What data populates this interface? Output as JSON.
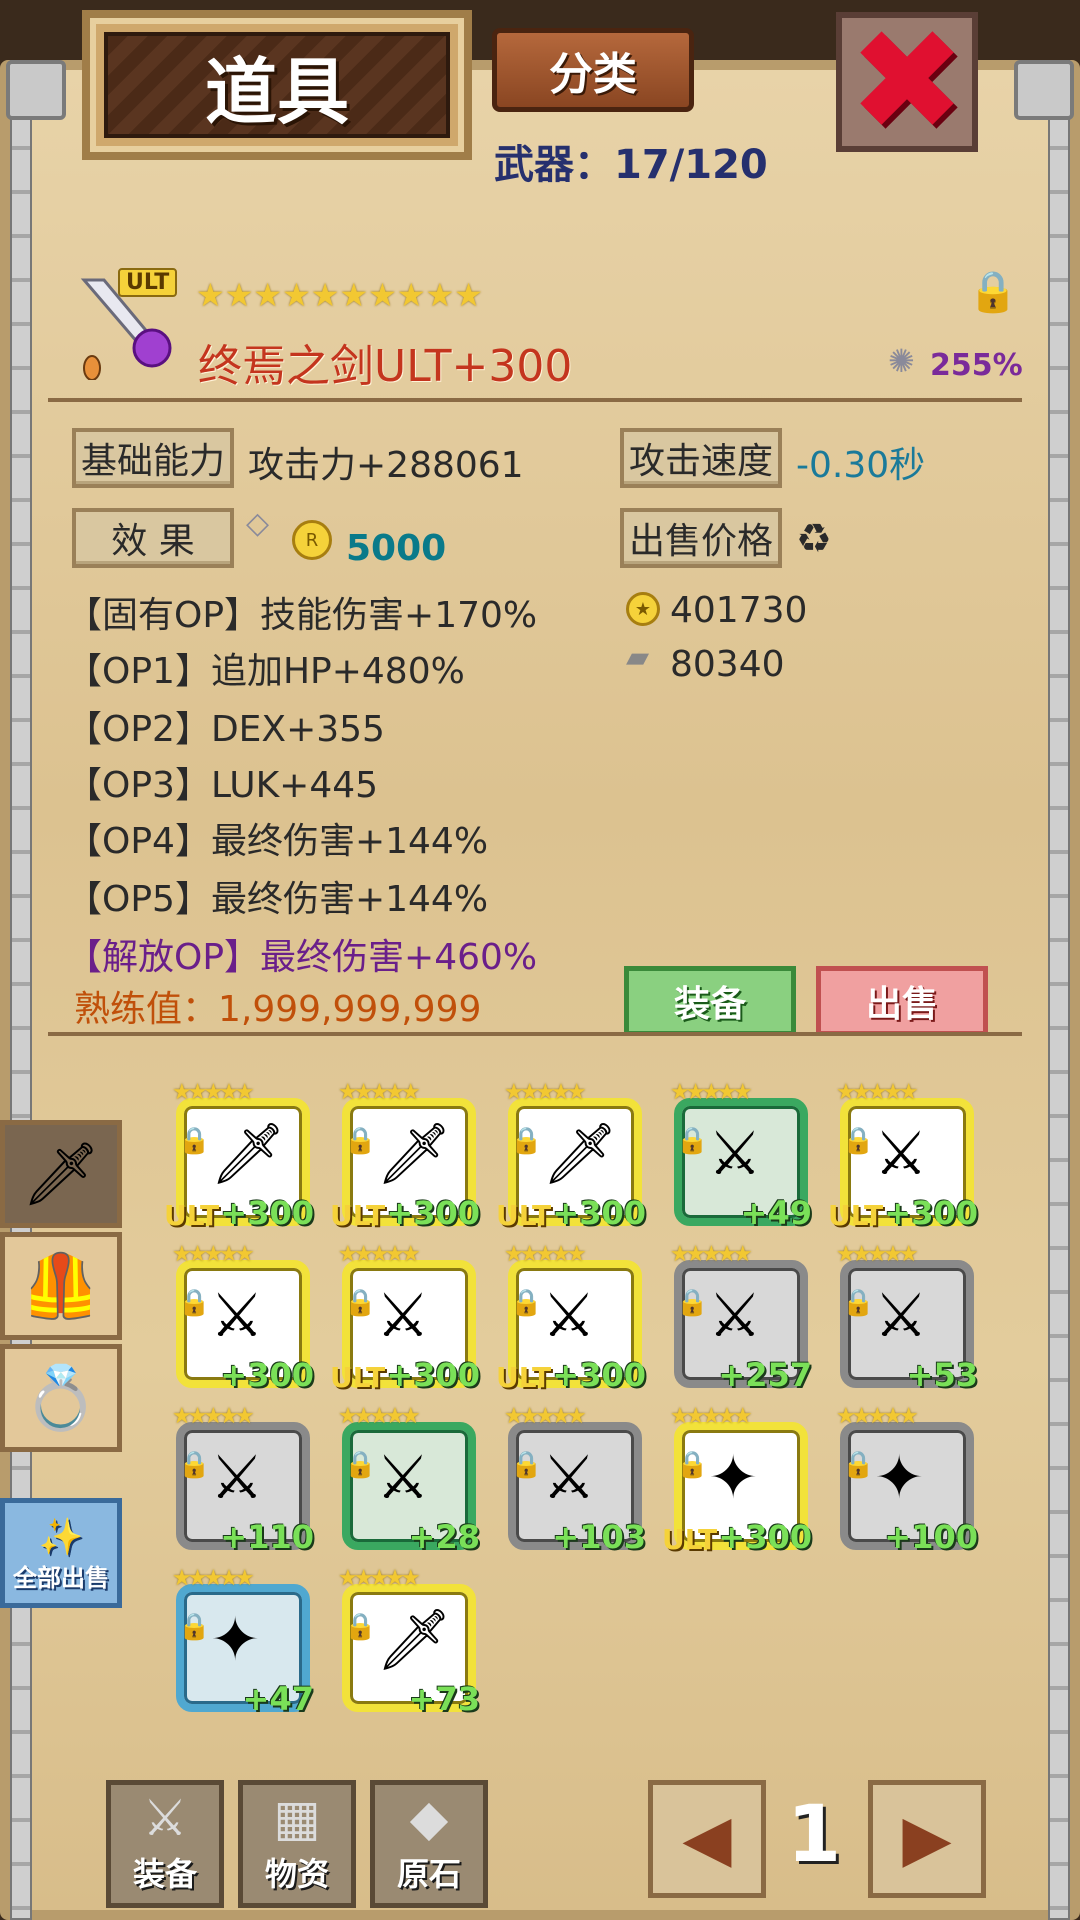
{
  "header": {
    "title": "道具",
    "category_label": "分类",
    "weapon_count": "武器：17/120",
    "close_glyph": "✖"
  },
  "item": {
    "ult_badge": "ULT",
    "stars": "★★★★★★★★★★",
    "name": "终焉之剑ULT+300",
    "percent": "255%",
    "base_label": "基础能力",
    "attack": "攻击力+288061",
    "speed_label": "攻击速度",
    "speed_value": "-0.30秒",
    "effect_label": "效 果",
    "rune_value": "5000",
    "sell_price_label": "出售价格",
    "options": [
      "【固有OP】技能伤害+170%",
      "【OP1】追加HP+480%",
      "【OP2】DEX+355",
      "【OP3】LUK+445",
      "【OP4】最终伤害+144%",
      "【OP5】最终伤害+144%",
      "【解放OP】最终伤害+460%"
    ],
    "mastery": "熟练值：1,999,999,999",
    "gold_price": "401730",
    "silver_price": "80340",
    "equip_label": "装备",
    "sell_label": "出售"
  },
  "side": {
    "sell_all_label": "全部出售"
  },
  "inventory": [
    {
      "stars": "★★★★★",
      "level": "+300",
      "ult": "ULT",
      "frame": "gold",
      "glyph": "🗡"
    },
    {
      "stars": "★★★★★",
      "level": "+300",
      "ult": "ULT",
      "frame": "gold",
      "glyph": "🗡"
    },
    {
      "stars": "★★★★★",
      "level": "+300",
      "ult": "ULT",
      "frame": "gold",
      "glyph": "🗡"
    },
    {
      "stars": "★★★★★",
      "level": "+49",
      "ult": "",
      "frame": "green",
      "glyph": "⚔"
    },
    {
      "stars": "★★★★★",
      "level": "+300",
      "ult": "ULT",
      "frame": "gold",
      "glyph": "⚔"
    },
    {
      "stars": "★★★★★",
      "level": "+300",
      "ult": "",
      "frame": "gold",
      "glyph": "⚔"
    },
    {
      "stars": "★★★★★",
      "level": "+300",
      "ult": "ULT",
      "frame": "gold",
      "glyph": "⚔"
    },
    {
      "stars": "★★★★★",
      "level": "+300",
      "ult": "ULT",
      "frame": "gold",
      "glyph": "⚔"
    },
    {
      "stars": "★★★★★",
      "level": "+257",
      "ult": "",
      "frame": "gray",
      "glyph": "⚔"
    },
    {
      "stars": "★★★★★",
      "level": "+53",
      "ult": "",
      "frame": "gray",
      "glyph": "⚔"
    },
    {
      "stars": "★★★★★",
      "level": "+110",
      "ult": "",
      "frame": "gray",
      "glyph": "⚔"
    },
    {
      "stars": "★★★★★",
      "level": "+28",
      "ult": "",
      "frame": "green",
      "glyph": "⚔"
    },
    {
      "stars": "★★★★★",
      "level": "+103",
      "ult": "",
      "frame": "gray",
      "glyph": "⚔"
    },
    {
      "stars": "★★★★★",
      "level": "+300",
      "ult": "ULT",
      "frame": "gold",
      "glyph": "✦"
    },
    {
      "stars": "★★★★★",
      "level": "+100",
      "ult": "",
      "frame": "gray",
      "glyph": "✦"
    },
    {
      "stars": "★★★★★",
      "level": "+47",
      "ult": "",
      "frame": "blue",
      "glyph": "✦"
    },
    {
      "stars": "★★★★★",
      "level": "+73",
      "ult": "",
      "frame": "gold",
      "glyph": "🗡"
    }
  ],
  "bottom": {
    "equip_tab": "装备",
    "material_tab": "物资",
    "ore_tab": "原石",
    "page": "1"
  }
}
